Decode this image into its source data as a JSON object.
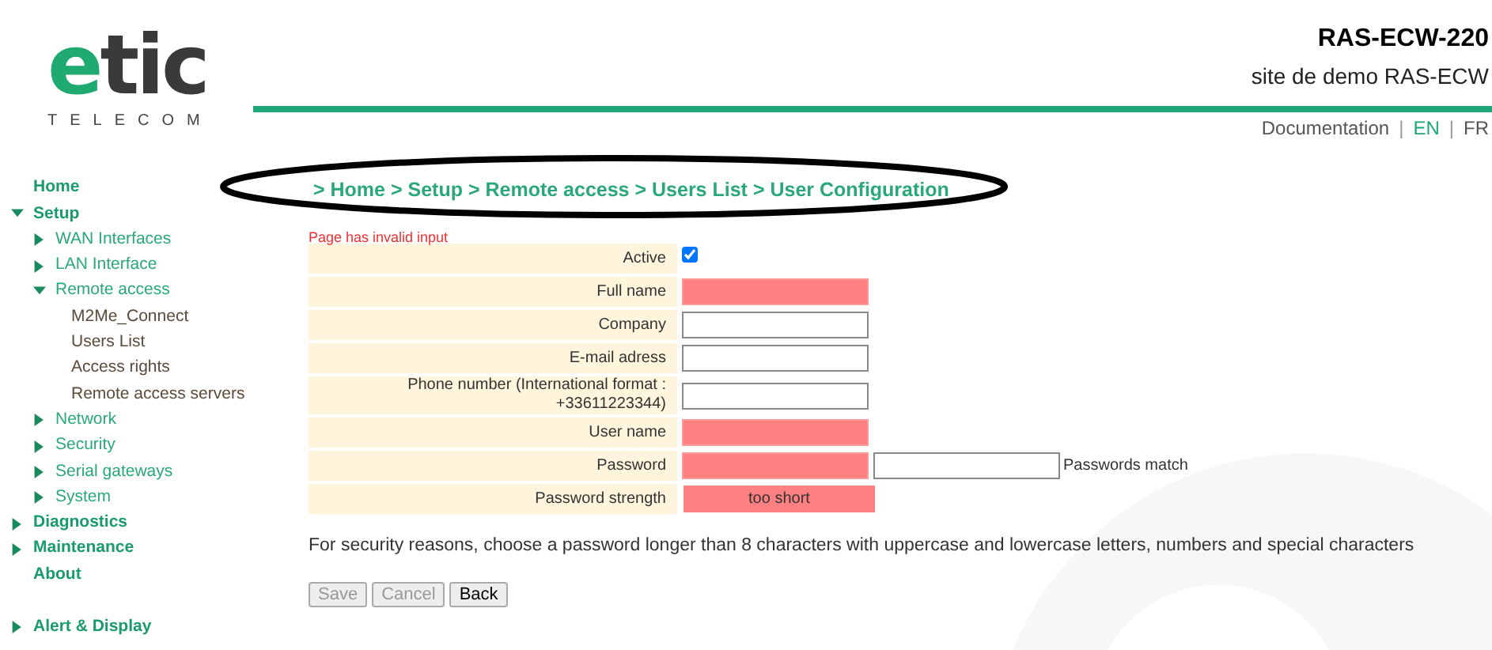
{
  "header": {
    "title": "RAS-ECW-220",
    "subtitle": "site de demo RAS-ECW",
    "links": [
      {
        "label": "Documentation",
        "selected": false
      },
      {
        "label": "EN",
        "selected": true
      },
      {
        "label": "FR",
        "selected": false
      }
    ],
    "separators": [
      "|",
      "|"
    ]
  },
  "logo": {
    "word": "etic",
    "tagline": "TELECOM"
  },
  "sidebar": {
    "items": [
      {
        "label": "Home"
      },
      {
        "label": "Setup",
        "expanded": true,
        "children": [
          {
            "label": "WAN Interfaces",
            "expanded": false
          },
          {
            "label": "LAN Interface",
            "expanded": false
          },
          {
            "label": "Remote access",
            "expanded": true,
            "children": [
              {
                "label": "M2Me_Connect"
              },
              {
                "label": "Users List"
              },
              {
                "label": "Access rights"
              },
              {
                "label": "Remote access servers"
              }
            ]
          },
          {
            "label": "Network",
            "expanded": false
          },
          {
            "label": "Security",
            "expanded": false
          },
          {
            "label": "Serial gateways",
            "expanded": false
          },
          {
            "label": "System",
            "expanded": false
          }
        ]
      },
      {
        "label": "Diagnostics",
        "expanded": false
      },
      {
        "label": "Maintenance",
        "expanded": false
      },
      {
        "label": "About"
      },
      {
        "label": "Alert & Display",
        "expanded": false,
        "gap": true
      }
    ]
  },
  "breadcrumb": [
    "Home",
    "Setup",
    "Remote access",
    "Users List",
    "User Configuration"
  ],
  "breadcrumb_separator": ">",
  "error": "Page has invalid input",
  "form": {
    "rows": [
      {
        "kind": "checkbox",
        "label": "Active",
        "checked": true
      },
      {
        "kind": "input",
        "label": "Full name",
        "invalid": true
      },
      {
        "kind": "input",
        "label": "Company",
        "invalid": false
      },
      {
        "kind": "input",
        "label": "E-mail adress",
        "invalid": false
      },
      {
        "kind": "input",
        "label": "Phone number (International format : +33611223344)",
        "invalid": false
      },
      {
        "kind": "input",
        "label": "User name",
        "invalid": true
      },
      {
        "kind": "pair",
        "label": "Password",
        "invalid": true,
        "confirm_invalid": false,
        "note": "Passwords match"
      },
      {
        "kind": "strength",
        "label": "Password strength",
        "value": "too short",
        "invalid": true
      }
    ]
  },
  "help": "For security reasons, choose a password longer than 8 characters with uppercase and lowercase letters, numbers and special characters",
  "buttons": [
    {
      "label": "Save",
      "disabled": true
    },
    {
      "label": "Cancel",
      "disabled": true
    },
    {
      "label": "Back",
      "disabled": false
    }
  ]
}
